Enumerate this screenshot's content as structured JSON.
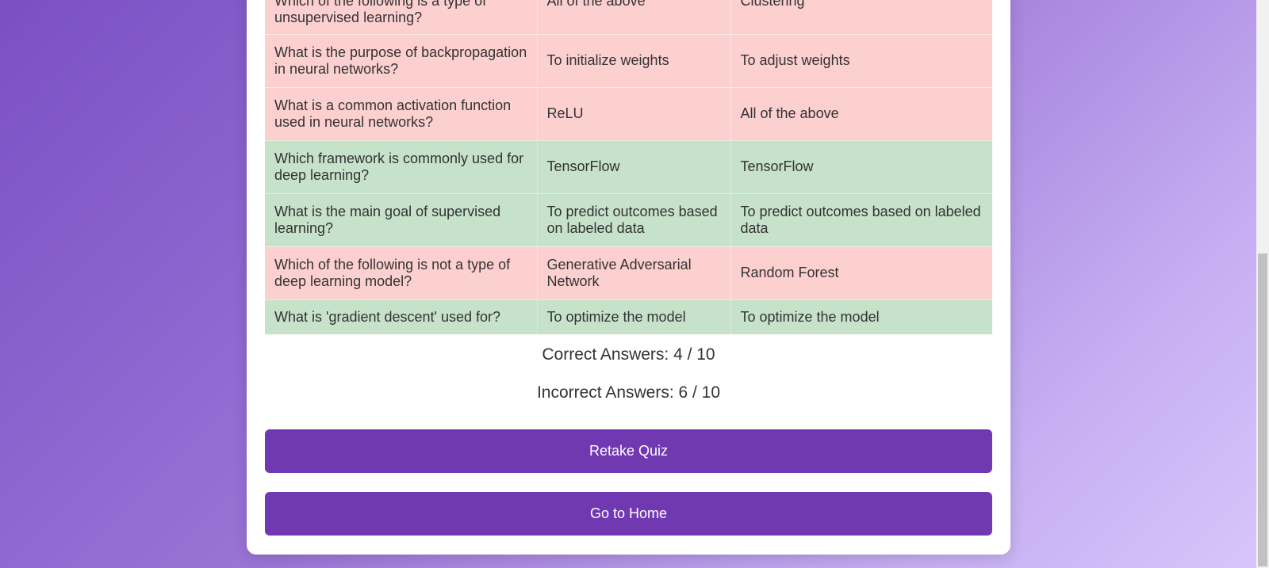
{
  "results": {
    "rows": [
      {
        "question": "Which of the following is a type of unsupervised learning?",
        "your_answer": "All of the above",
        "correct_answer": "Clustering",
        "status": "wrong"
      },
      {
        "question": "What is the purpose of backpropagation in neural networks?",
        "your_answer": "To initialize weights",
        "correct_answer": "To adjust weights",
        "status": "wrong"
      },
      {
        "question": "What is a common activation function used in neural networks?",
        "your_answer": "ReLU",
        "correct_answer": "All of the above",
        "status": "wrong"
      },
      {
        "question": "Which framework is commonly used for deep learning?",
        "your_answer": "TensorFlow",
        "correct_answer": "TensorFlow",
        "status": "right"
      },
      {
        "question": "What is the main goal of supervised learning?",
        "your_answer": "To predict outcomes based on labeled data",
        "correct_answer": "To predict outcomes based on labeled data",
        "status": "right"
      },
      {
        "question": "Which of the following is not a type of deep learning model?",
        "your_answer": "Generative Adversarial Network",
        "correct_answer": "Random Forest",
        "status": "wrong"
      },
      {
        "question": "What is 'gradient descent' used for?",
        "your_answer": "To optimize the model",
        "correct_answer": "To optimize the model",
        "status": "right"
      }
    ]
  },
  "summary": {
    "correct": "Correct Answers: 4 / 10",
    "incorrect": "Incorrect Answers: 6 / 10"
  },
  "buttons": {
    "retake": "Retake Quiz",
    "home": "Go to Home"
  },
  "colors": {
    "wrong_row": "#fdd0d0",
    "right_row": "#c6e2ca",
    "button": "#7039b2"
  }
}
